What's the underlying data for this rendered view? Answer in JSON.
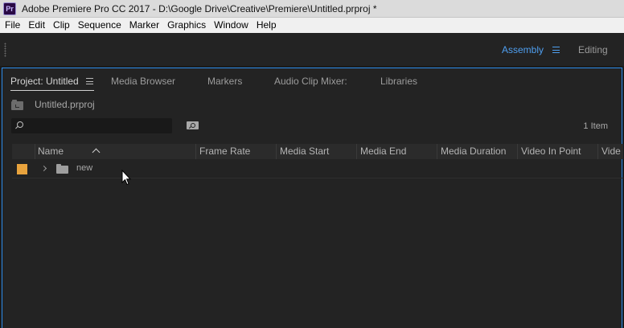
{
  "window": {
    "app_icon": "Pr",
    "title": "Adobe Premiere Pro CC 2017 - D:\\Google Drive\\Creative\\Premiere\\Untitled.prproj *"
  },
  "menubar": {
    "items": [
      "File",
      "Edit",
      "Clip",
      "Sequence",
      "Marker",
      "Graphics",
      "Window",
      "Help"
    ]
  },
  "workspaces": {
    "active": "Assembly",
    "other": "Editing",
    "accent_color": "#4f9ff0"
  },
  "panel": {
    "tabs": [
      "Project: Untitled",
      "Media Browser",
      "Markers",
      "Audio Clip Mixer:",
      "Libraries"
    ],
    "active_tab": "Project: Untitled",
    "project_file": "Untitled.prproj",
    "search": {
      "value": "",
      "placeholder": ""
    },
    "item_count": "1 Item",
    "columns": [
      "Name",
      "Frame Rate",
      "Media Start",
      "Media End",
      "Media Duration",
      "Video In Point",
      "Vide"
    ],
    "sort_column": "Name",
    "rows": [
      {
        "label_color": "#e8a33d",
        "icon": "folder-bin-icon",
        "name": "new"
      }
    ]
  }
}
